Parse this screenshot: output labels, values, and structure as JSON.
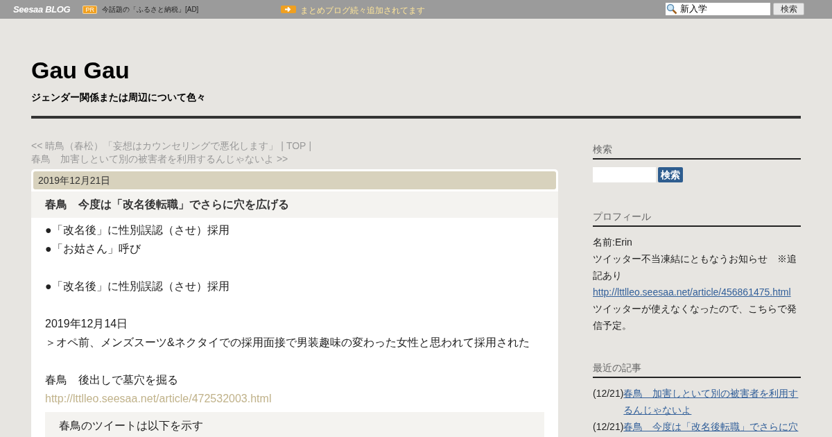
{
  "top_bar": {
    "logo": "Seesaa BLOG",
    "pr_badge": "PR",
    "ad_text": "今話題の「ふるさと納税」[AD]",
    "notice": "まとめブログ続々追加されてます",
    "search": {
      "value": "新入学"
    },
    "search_button": "検索"
  },
  "header": {
    "title": "Gau Gau",
    "subtitle": "ジェンダー関係または周辺について色々"
  },
  "nav": {
    "prev": "<< 晴鳥（春松）「妄想はカウンセリングで悪化します」",
    "separator_1": "|",
    "top": "TOP",
    "separator_2": "|",
    "next": "春鳥　加害しといて別の被害者を利用するんじゃないよ >>"
  },
  "article": {
    "date": "2019年12月21日",
    "title": "春鳥　今度は「改名後転職」でさらに穴を広げる",
    "paragraphs": [
      [
        {
          "kind": "text",
          "text": "●「改名後」に性別誤認（させ）採用"
        },
        {
          "kind": "text",
          "text": "●「お姑さん」呼び"
        }
      ],
      [
        {
          "kind": "text",
          "text": "●「改名後」に性別誤認（させ）採用"
        }
      ],
      [
        {
          "kind": "text",
          "text": "2019年12月14日"
        },
        {
          "kind": "text",
          "text": "＞オペ前、メンズスーツ&ネクタイでの採用面接で男装趣味の変わった女性と思われて採用された"
        }
      ],
      [
        {
          "kind": "text",
          "text": "春鳥　後出しで墓穴を掘る"
        },
        {
          "kind": "link",
          "text": "http://lttlleo.seesaa.net/article/472532003.html"
        }
      ]
    ],
    "quote": "春鳥のツイートは以下を示す"
  },
  "sidebar": {
    "search": {
      "heading": "検索",
      "button": "検索"
    },
    "profile": {
      "heading": "プロフィール",
      "lines": [
        {
          "kind": "text",
          "text": "名前:Erin"
        },
        {
          "kind": "text",
          "text": "ツイッター不当凍結にともなうお知らせ　※追記あり"
        },
        {
          "kind": "link",
          "text": "http://lttlleo.seesaa.net/article/456861475.html"
        },
        {
          "kind": "text",
          "text": "ツイッターが使えなくなったので、こちらで発信予定。"
        }
      ]
    },
    "recent": {
      "heading": "最近の記事",
      "items": [
        {
          "date": "(12/21)",
          "title": "春鳥　加害しといて別の被害者を利用するんじゃないよ"
        },
        {
          "date": "(12/21)",
          "title": "春鳥　今度は「改名後転職」でさらに穴"
        }
      ]
    }
  }
}
